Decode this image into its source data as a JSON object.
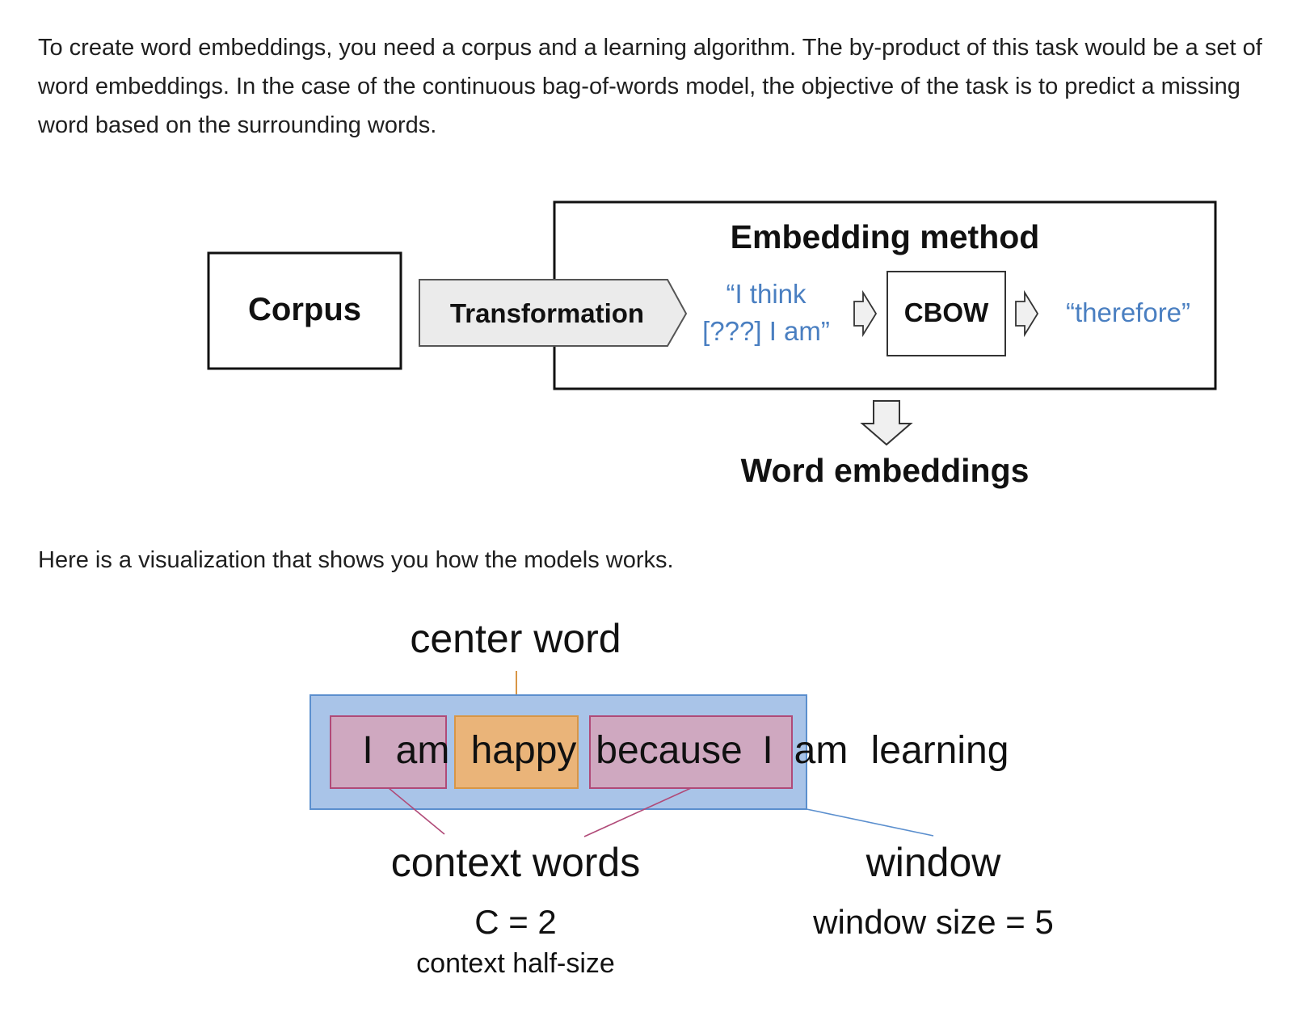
{
  "intro_paragraph": "To create word embeddings, you need a corpus and a learning algorithm. The by-product of this task would be a set of word embeddings. In the case of the continuous bag-of-words model, the objective of the task is to predict a missing word based on the surrounding words.",
  "pipeline_diagram": {
    "corpus_label": "Corpus",
    "transformation_label": "Transformation",
    "embedding_method_title": "Embedding method",
    "input_example_line1": "“I think",
    "input_example_line2": "[???] I am”",
    "model_label": "CBOW",
    "output_example": "“therefore”",
    "result_label": "Word embeddings",
    "colors": {
      "example_text": "#4a7fc1",
      "transformation_fill": "#ebebeb",
      "arrow_fill": "#f0f0f0"
    }
  },
  "visualization_intro": "Here is a visualization that shows you how the models works.",
  "window_diagram": {
    "center_word_caption": "center word",
    "sentence_words": [
      "I",
      "am",
      "happy",
      "because",
      "I",
      "am",
      "learning"
    ],
    "context_words_caption": "context words",
    "context_formula": "C = 2",
    "context_caption": "context half-size",
    "window_caption": "window",
    "window_formula": "window size = 5",
    "colors": {
      "window_fill": "#a9c4e8",
      "window_border": "#5b8fce",
      "context_fill": "#cfa8c0",
      "context_border": "#b04a78",
      "center_fill": "#eab479",
      "center_border": "#d89646"
    }
  }
}
